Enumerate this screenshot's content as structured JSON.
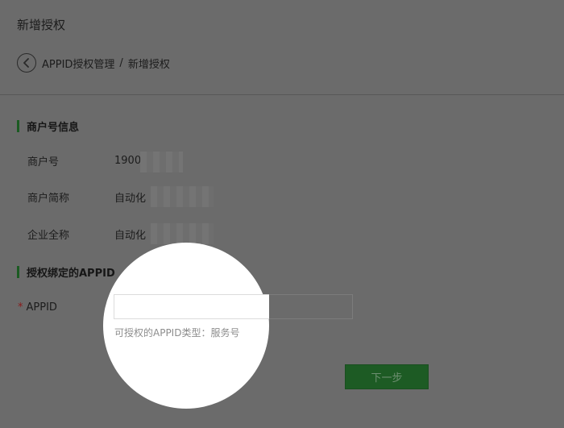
{
  "header": {
    "title": "新增授权",
    "breadcrumb": {
      "parent": "APPID授权管理",
      "separator": "/",
      "current": "新增授权"
    }
  },
  "merchant_section": {
    "title": "商户号信息",
    "rows": [
      {
        "label": "商户号",
        "value": "1900"
      },
      {
        "label": "商户简称",
        "value": "自动化"
      },
      {
        "label": "企业全称",
        "value": "自动化"
      }
    ]
  },
  "appid_section": {
    "title": "授权绑定的APPID",
    "field_label": "APPID",
    "required_mark": "*",
    "input_value": "",
    "input_placeholder": "",
    "hint": "可授权的APPID类型：服务号"
  },
  "actions": {
    "next_label": "下一步"
  },
  "colors": {
    "accent_green": "#1d5b24",
    "required_red": "#8b1a1a",
    "overlay_gray": "#6b6b6b",
    "spotlight_white": "#ffffff"
  },
  "icons": {
    "back": "chevron-left-circle-icon"
  }
}
